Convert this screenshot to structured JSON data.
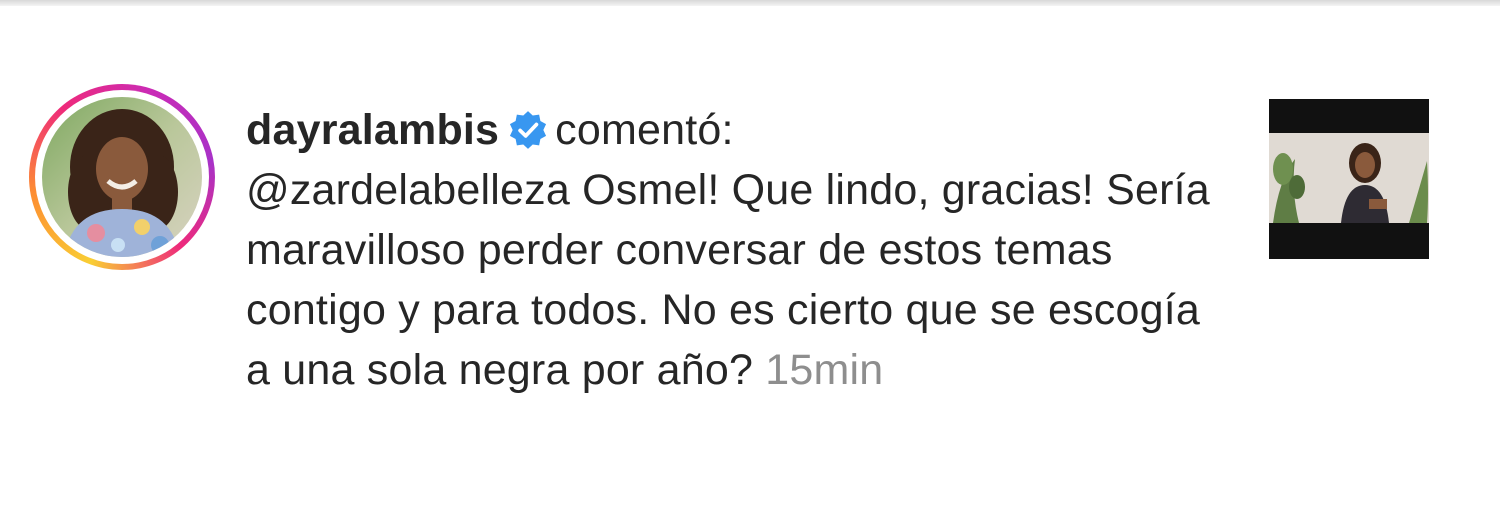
{
  "notification": {
    "username": "dayralambis",
    "verified": true,
    "action": "comentó:",
    "mention": "@zardelabelleza",
    "message": " Osmel! Que lindo, gracias! Sería maravilloso perder conversar de estos temas contigo y para todos. No es cierto que se escogía a una sola negra por año?",
    "time": "15min",
    "avatar_icon": "profile-photo",
    "thumbnail_icon": "post-preview-video",
    "colors": {
      "verified_blue": "#3897f0",
      "text": "#262626",
      "muted": "#8e8e8e"
    }
  }
}
